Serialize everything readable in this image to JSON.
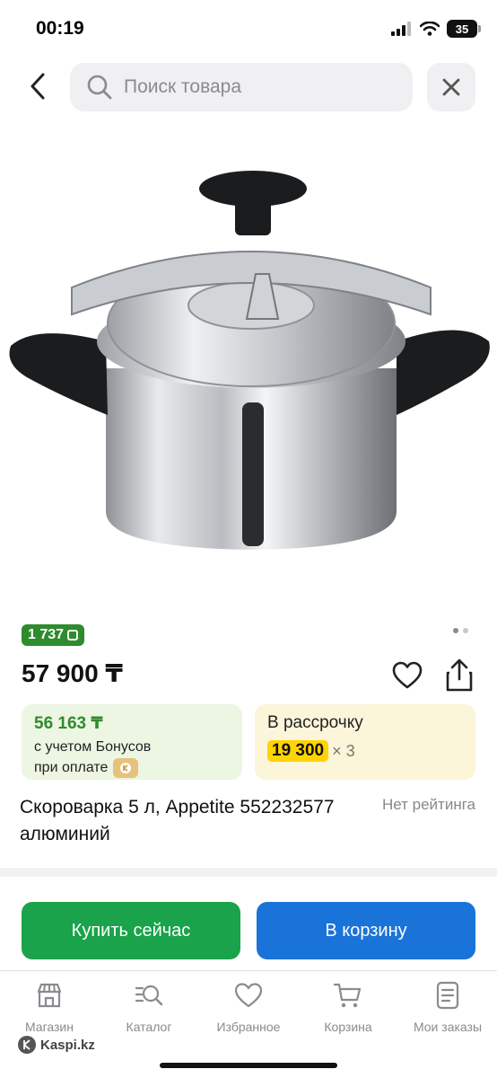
{
  "status_bar": {
    "time": "00:19",
    "battery": "35"
  },
  "search": {
    "placeholder": "Поиск товара"
  },
  "product": {
    "bonus_points": "1 737",
    "price": "57 900 ₸",
    "bonus_card": {
      "amount": "56 163 ₸",
      "line1": "с учетом Бонусов",
      "line2": "при оплате"
    },
    "installment_card": {
      "title": "В рассрочку",
      "monthly": "19 300",
      "multiplier": "× 3"
    },
    "title": "Скороварка 5 л, Appetite 552232577 алюминий",
    "rating_text": "Нет рейтинга",
    "image_icon": "pressure-cooker-icon"
  },
  "actions": {
    "buy_now": "Купить сейчас",
    "add_to_cart": "В корзину"
  },
  "tabbar": {
    "items": [
      {
        "label": "Магазин",
        "icon": "store-icon"
      },
      {
        "label": "Каталог",
        "icon": "catalog-search-icon"
      },
      {
        "label": "Избранное",
        "icon": "heart-icon"
      },
      {
        "label": "Корзина",
        "icon": "cart-icon"
      },
      {
        "label": "Мои заказы",
        "icon": "orders-icon"
      }
    ]
  },
  "brand": {
    "name": "Kaspi.kz"
  },
  "colors": {
    "green": "#1aa34a",
    "blue": "#1a73d8",
    "bonus_green": "#2e8b2e",
    "installment_yellow": "#ffd400"
  }
}
